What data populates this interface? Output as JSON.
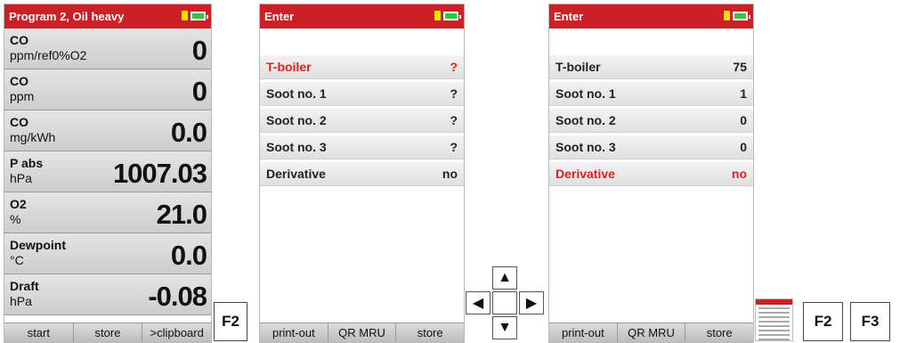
{
  "screen1": {
    "title": "Program 2, Oil heavy",
    "rows": [
      {
        "name": "CO",
        "unit": "ppm/ref0%O2",
        "value": "0"
      },
      {
        "name": "CO",
        "unit": "ppm",
        "value": "0"
      },
      {
        "name": "CO",
        "unit": "mg/kWh",
        "value": "0.0"
      },
      {
        "name": "P abs",
        "unit": "hPa",
        "value": "1007.03"
      },
      {
        "name": "O2",
        "unit": "%",
        "value": "21.0"
      },
      {
        "name": "Dewpoint",
        "unit": "°C",
        "value": "0.0"
      },
      {
        "name": "Draft",
        "unit": "hPa",
        "value": "-0.08"
      }
    ],
    "softkeys": [
      "start",
      "store",
      ">clipboard"
    ]
  },
  "fkey_a": "F2",
  "screen2": {
    "title": "Enter",
    "rows": [
      {
        "label": "T-boiler",
        "value": "?"
      },
      {
        "label": "Soot no. 1",
        "value": "?"
      },
      {
        "label": "Soot no. 2",
        "value": "?"
      },
      {
        "label": "Soot no. 3",
        "value": "?"
      },
      {
        "label": "Derivative",
        "value": "no"
      }
    ],
    "softkeys": [
      "print-out",
      "QR MRU",
      "store"
    ]
  },
  "arrows": {
    "up": "▲",
    "left": "◀",
    "right": "▶",
    "down": "▼"
  },
  "screen3": {
    "title": "Enter",
    "rows": [
      {
        "label": "T-boiler",
        "value": "75"
      },
      {
        "label": "Soot no. 1",
        "value": "1"
      },
      {
        "label": "Soot no. 2",
        "value": "0"
      },
      {
        "label": "Soot no. 3",
        "value": "0"
      },
      {
        "label": "Derivative",
        "value": "no"
      }
    ],
    "softkeys": [
      "print-out",
      "QR MRU",
      "store"
    ]
  },
  "fkey_b": "F2",
  "fkey_c": "F3",
  "colors": {
    "titlebar": "#cf1f26",
    "highlight": "#e02020",
    "battery": "#2ec93c",
    "sdcard": "#e8e200"
  }
}
